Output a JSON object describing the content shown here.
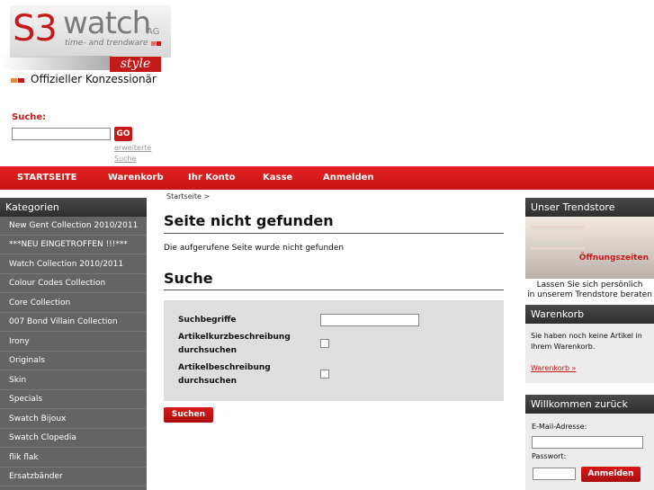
{
  "logo": {
    "s3": "S3",
    "watch": "watch",
    "ag": "AG",
    "tagline": "time- and trendware",
    "style": "style",
    "konzessionaer": "Offizieller Konzessionär"
  },
  "search": {
    "label": "Suche:",
    "go": "GO",
    "advanced": "erweiterte Suche",
    "input_value": ""
  },
  "nav": [
    "STARTSEITE",
    "Warenkorb",
    "Ihr Konto",
    "Kasse",
    "Anmelden"
  ],
  "categories": {
    "title": "Kategorien",
    "items": [
      "New Gent Collection 2010/2011",
      "***NEU EINGETROFFEN !!!***",
      "Watch Collection 2010/2011",
      "Colour Codes Collection",
      "Core Collection",
      "007 Bond Villain Collection",
      "Irony",
      "Originals",
      "Skin",
      "Specials",
      "Swatch Bijoux",
      "Swatch Clopedia",
      "flik flak",
      "Ersatzbänder"
    ]
  },
  "main": {
    "breadcrumb": "Startseite >",
    "title": "Seite nicht gefunden",
    "message": "Die aufgerufene Seite wurde nicht gefunden",
    "search_title": "Suche",
    "form": {
      "term_label": "Suchbegriffe",
      "short_desc_label_1": "Artikelkurzbeschreibung",
      "short_desc_label_2": "durchsuchen",
      "desc_label_1": "Artikelbeschreibung",
      "desc_label_2": "durchsuchen"
    },
    "submit": "Suchen"
  },
  "right": {
    "trendstore_title": "Unser Trendstore",
    "opening_hours": "Öffnungszeiten",
    "trendstore_text_1": "Lassen Sie sich persönlich",
    "trendstore_text_2": "in unserem Trendstore beraten",
    "cart_title": "Warenkorb",
    "cart_text": "Sie haben noch keine Artikel in Ihrem Warenkorb.",
    "cart_link": "Warenkorb »",
    "welcome_title": "Willkommen zurück",
    "email_label": "E-Mail-Adresse:",
    "password_label": "Passwort:",
    "login_button": "Anmelden"
  }
}
